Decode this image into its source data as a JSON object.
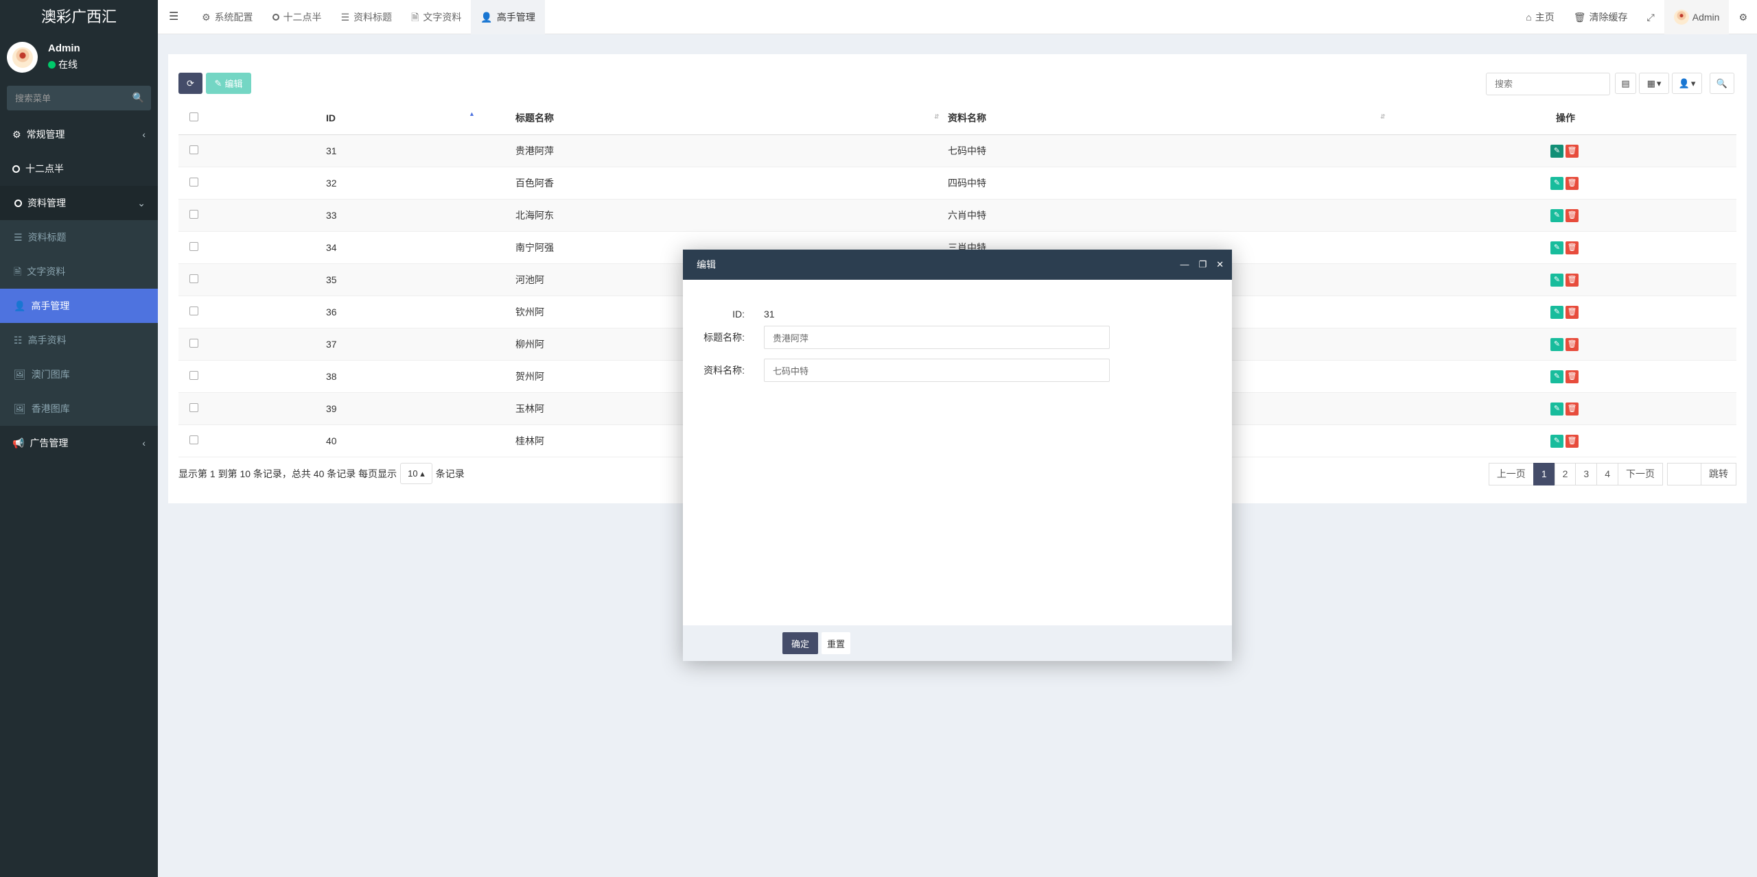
{
  "sidebar": {
    "brand": "澳彩广西汇",
    "user": {
      "name": "Admin",
      "status": "在线"
    },
    "search_placeholder": "搜索菜单",
    "menu": {
      "general": "常规管理",
      "half": "十二点半",
      "data_mgmt": "资料管理",
      "items": [
        "资料标题",
        "文字资料",
        "高手管理",
        "高手资料",
        "澳门图库",
        "香港图库"
      ],
      "ads": "广告管理"
    }
  },
  "topbar": {
    "tabs": [
      "系统配置",
      "十二点半",
      "资料标题",
      "文字资料",
      "高手管理"
    ],
    "home": "主页",
    "clear_cache": "清除缓存",
    "admin": "Admin"
  },
  "toolbar": {
    "edit_label": "编辑",
    "search_placeholder": "搜索"
  },
  "table": {
    "headers": [
      "ID",
      "标题名称",
      "资料名称",
      "操作"
    ],
    "rows": [
      {
        "id": "31",
        "title": "贵港阿萍",
        "name": "七码中特"
      },
      {
        "id": "32",
        "title": "百色阿香",
        "name": "四码中特"
      },
      {
        "id": "33",
        "title": "北海阿东",
        "name": "六肖中特"
      },
      {
        "id": "34",
        "title": "南宁阿强",
        "name": "三肖中特"
      },
      {
        "id": "35",
        "title": "河池阿",
        "name": ""
      },
      {
        "id": "36",
        "title": "钦州阿",
        "name": ""
      },
      {
        "id": "37",
        "title": "柳州阿",
        "name": ""
      },
      {
        "id": "38",
        "title": "贺州阿",
        "name": ""
      },
      {
        "id": "39",
        "title": "玉林阿",
        "name": ""
      },
      {
        "id": "40",
        "title": "桂林阿",
        "name": ""
      }
    ]
  },
  "pagination": {
    "info_prefix": "显示第 1 到第 10 条记录，总共 40 条记录 每页显示",
    "page_size": "10",
    "info_suffix": "条记录",
    "prev": "上一页",
    "pages": [
      "1",
      "2",
      "3",
      "4"
    ],
    "next": "下一页",
    "jump": "跳转"
  },
  "modal": {
    "title": "编辑",
    "id_label": "ID:",
    "id_value": "31",
    "title_label": "标题名称:",
    "title_value": "贵港阿萍",
    "name_label": "资料名称:",
    "name_value": "七码中特",
    "ok": "确定",
    "reset": "重置"
  }
}
